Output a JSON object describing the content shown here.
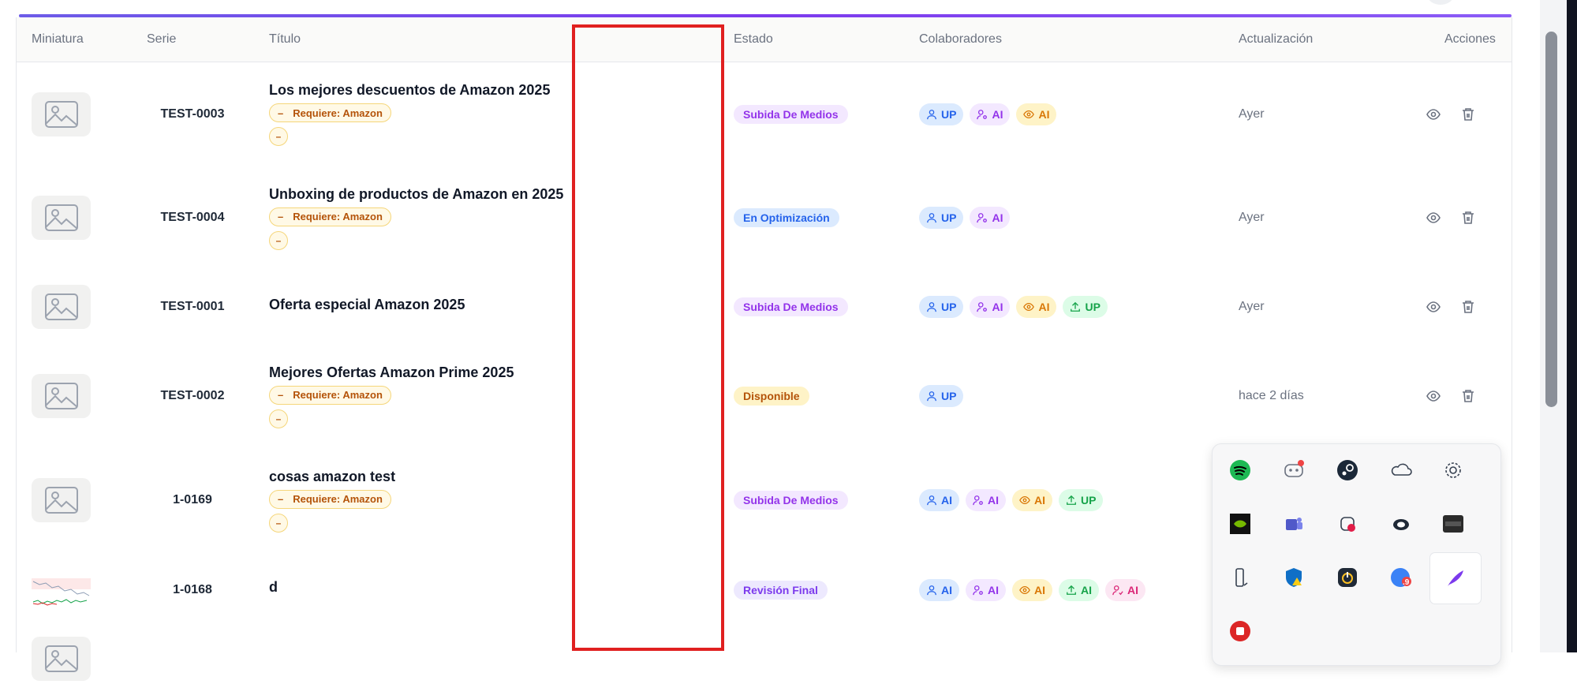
{
  "table": {
    "headers": {
      "miniatura": "Miniatura",
      "serie": "Serie",
      "titulo": "Título",
      "estado": "Estado",
      "colaboradores": "Colaboradores",
      "actualizacion": "Actualización",
      "acciones": "Acciones"
    },
    "rows": [
      {
        "serie": "TEST-0003",
        "title": "Los mejores descuentos de Amazon 2025",
        "req_label": "Requiere: Amazon",
        "req_dash": "–",
        "estado": "Subida De Medios",
        "collab": [
          {
            "label": "UP",
            "icon": "user-icon"
          },
          {
            "label": "AI",
            "icon": "user-gear-icon"
          },
          {
            "label": "AI",
            "icon": "eye-icon"
          }
        ],
        "updated": "Ayer"
      },
      {
        "serie": "TEST-0004",
        "title": "Unboxing de productos de Amazon en 2025",
        "req_label": "Requiere: Amazon",
        "req_dash": "–",
        "estado": "En Optimización",
        "collab": [
          {
            "label": "UP",
            "icon": "user-icon"
          },
          {
            "label": "AI",
            "icon": "user-gear-icon"
          }
        ],
        "updated": "Ayer"
      },
      {
        "serie": "TEST-0001",
        "title": "Oferta especial Amazon 2025",
        "estado": "Subida De Medios",
        "collab": [
          {
            "label": "UP",
            "icon": "user-icon"
          },
          {
            "label": "AI",
            "icon": "user-gear-icon"
          },
          {
            "label": "AI",
            "icon": "eye-icon"
          },
          {
            "label": "UP",
            "icon": "upload-icon"
          }
        ],
        "updated": "Ayer"
      },
      {
        "serie": "TEST-0002",
        "title": "Mejores Ofertas Amazon Prime 2025",
        "req_label": "Requiere: Amazon",
        "req_dash": "–",
        "estado": "Disponible",
        "collab": [
          {
            "label": "UP",
            "icon": "user-icon"
          }
        ],
        "updated": "hace 2 días"
      },
      {
        "serie": "1-0169",
        "title": "cosas amazon test",
        "req_label": "Requiere: Amazon",
        "req_dash": "–",
        "estado": "Subida De Medios",
        "collab": [
          {
            "label": "AI",
            "icon": "user-icon"
          },
          {
            "label": "AI",
            "icon": "user-gear-icon"
          },
          {
            "label": "AI",
            "icon": "eye-icon"
          },
          {
            "label": "UP",
            "icon": "upload-icon"
          }
        ],
        "updated": ""
      },
      {
        "serie": "1-0168",
        "title": "d",
        "estado": "Revisión Final",
        "collab": [
          {
            "label": "AI",
            "icon": "user-icon"
          },
          {
            "label": "AI",
            "icon": "user-gear-icon"
          },
          {
            "label": "AI",
            "icon": "eye-icon"
          },
          {
            "label": "AI",
            "icon": "upload-icon"
          },
          {
            "label": "AI",
            "icon": "user-check-icon"
          }
        ],
        "updated": ""
      }
    ]
  },
  "colors": {
    "accent": "#7c3aed",
    "estado_subida_bg": "#f3e8ff",
    "estado_subida_fg": "#9333ea",
    "estado_optim_bg": "#dbeafe",
    "estado_optim_fg": "#2563eb",
    "estado_disp_bg": "#fef3c7",
    "estado_disp_fg": "#b45309",
    "estado_rev_bg": "#ede9fe",
    "estado_rev_fg": "#7c3aed",
    "highlight": "#e02020"
  },
  "tray": {
    "icons": [
      "spotify-icon",
      "discord-icon",
      "steam-icon",
      "onedrive-icon",
      "settings-gear-icon",
      "nvidia-icon",
      "teams-icon",
      "slack-icon",
      "creative-cloud-icon",
      "app-icon",
      "usb-drive-icon",
      "defender-warning-icon",
      "power-toys-icon",
      "notification-badge-icon",
      "feather-icon",
      "red-app-icon"
    ],
    "badge_text": ".9"
  }
}
